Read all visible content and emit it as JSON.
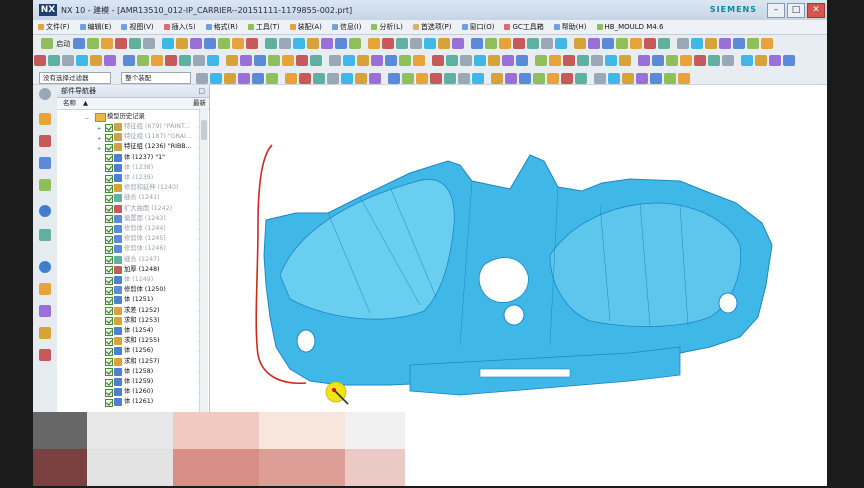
{
  "window": {
    "logo": "NX",
    "title": "NX 10 - 建模 - [AMR13510_012-IP_CARRIER--20151111-1179855-002.prt]",
    "brand": "SIEMENS",
    "minimize": "–",
    "maximize": "□",
    "close": "✕"
  },
  "menu": [
    {
      "label": "文件(F)",
      "color": "#e8a23a"
    },
    {
      "label": "编辑(E)",
      "color": "#6fa3d8"
    },
    {
      "label": "视图(V)",
      "color": "#6fa3d8"
    },
    {
      "label": "插入(S)",
      "color": "#d86f6f"
    },
    {
      "label": "格式(R)",
      "color": "#6fa3d8"
    },
    {
      "label": "工具(T)",
      "color": "#8fbf5a"
    },
    {
      "label": "装配(A)",
      "color": "#e8a23a"
    },
    {
      "label": "信息(I)",
      "color": "#6fa3d8"
    },
    {
      "label": "分析(L)",
      "color": "#8fbf5a"
    },
    {
      "label": "首选项(P)",
      "color": "#d8b36f"
    },
    {
      "label": "窗口(O)",
      "color": "#6fa3d8"
    },
    {
      "label": "GC工具箱",
      "color": "#d86f6f"
    },
    {
      "label": "帮助(H)",
      "color": "#6fa3d8"
    },
    {
      "label": "HB_MOULD M4.6",
      "color": "#8fbf5a"
    }
  ],
  "toolbar": {
    "start_label": "启动",
    "filter_select": "没有选择过滤器",
    "scope_select": "整个装配"
  },
  "navigator": {
    "title": "部件导航器",
    "col_name": "名称",
    "sort_icon": "▲",
    "col_recent": "最新",
    "root": "模型历史记录",
    "items": [
      {
        "label": "特征组 (679) \"PAINT...",
        "dim": true,
        "color": "#c9a24a",
        "twisty": "+"
      },
      {
        "label": "特征组 (1187) \"GRAI...",
        "dim": true,
        "color": "#c9a24a",
        "twisty": "+"
      },
      {
        "label": "特征组 (1236) \"RIBB...",
        "dim": false,
        "color": "#c9a24a",
        "twisty": "+"
      },
      {
        "label": "体 (1237) \"1\"",
        "dim": false,
        "color": "#4f7fd0",
        "twisty": ""
      },
      {
        "label": "体 (1238)",
        "dim": true,
        "color": "#4f7fd0",
        "twisty": ""
      },
      {
        "label": "体 (1239)",
        "dim": true,
        "color": "#4f7fd0",
        "twisty": ""
      },
      {
        "label": "修剪和延伸 (1240)",
        "dim": true,
        "color": "#d8a23a",
        "twisty": ""
      },
      {
        "label": "缝合 (1241)",
        "dim": true,
        "color": "#5fb0a0",
        "twisty": ""
      },
      {
        "label": "扩大曲面 (1242)",
        "dim": true,
        "color": "#c65a5a",
        "twisty": ""
      },
      {
        "label": "偏置面 (1243)",
        "dim": true,
        "color": "#5a8ad8",
        "twisty": ""
      },
      {
        "label": "修剪体 (1244)",
        "dim": true,
        "color": "#5a8ad8",
        "twisty": ""
      },
      {
        "label": "修剪体 (1245)",
        "dim": true,
        "color": "#5a8ad8",
        "twisty": ""
      },
      {
        "label": "修剪体 (1246)",
        "dim": true,
        "color": "#5a8ad8",
        "twisty": ""
      },
      {
        "label": "缝合 (1247)",
        "dim": true,
        "color": "#5fb0a0",
        "twisty": ""
      },
      {
        "label": "加厚 (1248)",
        "dim": false,
        "color": "#c65a5a",
        "twisty": ""
      },
      {
        "label": "体 (1249)",
        "dim": true,
        "color": "#4f7fd0",
        "twisty": ""
      },
      {
        "label": "修剪体 (1250)",
        "dim": false,
        "color": "#5a8ad8",
        "twisty": ""
      },
      {
        "label": "体 (1251)",
        "dim": false,
        "color": "#4f7fd0",
        "twisty": ""
      },
      {
        "label": "求差 (1252)",
        "dim": false,
        "color": "#d8a23a",
        "twisty": ""
      },
      {
        "label": "求和 (1253)",
        "dim": false,
        "color": "#d8a23a",
        "twisty": ""
      },
      {
        "label": "体 (1254)",
        "dim": false,
        "color": "#4f7fd0",
        "twisty": ""
      },
      {
        "label": "求和 (1255)",
        "dim": false,
        "color": "#d8a23a",
        "twisty": ""
      },
      {
        "label": "体 (1256)",
        "dim": false,
        "color": "#4f7fd0",
        "twisty": ""
      },
      {
        "label": "求和 (1257)",
        "dim": false,
        "color": "#d8a23a",
        "twisty": ""
      },
      {
        "label": "体 (1258)",
        "dim": false,
        "color": "#4f7fd0",
        "twisty": ""
      },
      {
        "label": "体 (1259)",
        "dim": false,
        "color": "#4f7fd0",
        "twisty": ""
      },
      {
        "label": "体 (1260)",
        "dim": false,
        "color": "#4f7fd0",
        "twisty": ""
      },
      {
        "label": "体 (1261)",
        "dim": false,
        "color": "#4f7fd0",
        "twisty": ""
      }
    ]
  },
  "colors": {
    "part": "#3fb8e8",
    "part_dark": "#1f86c4",
    "sketch": "#cc2a1a",
    "marker": "#f2e21a"
  },
  "icons": {
    "cursor": "mouse-pointer-icon"
  }
}
